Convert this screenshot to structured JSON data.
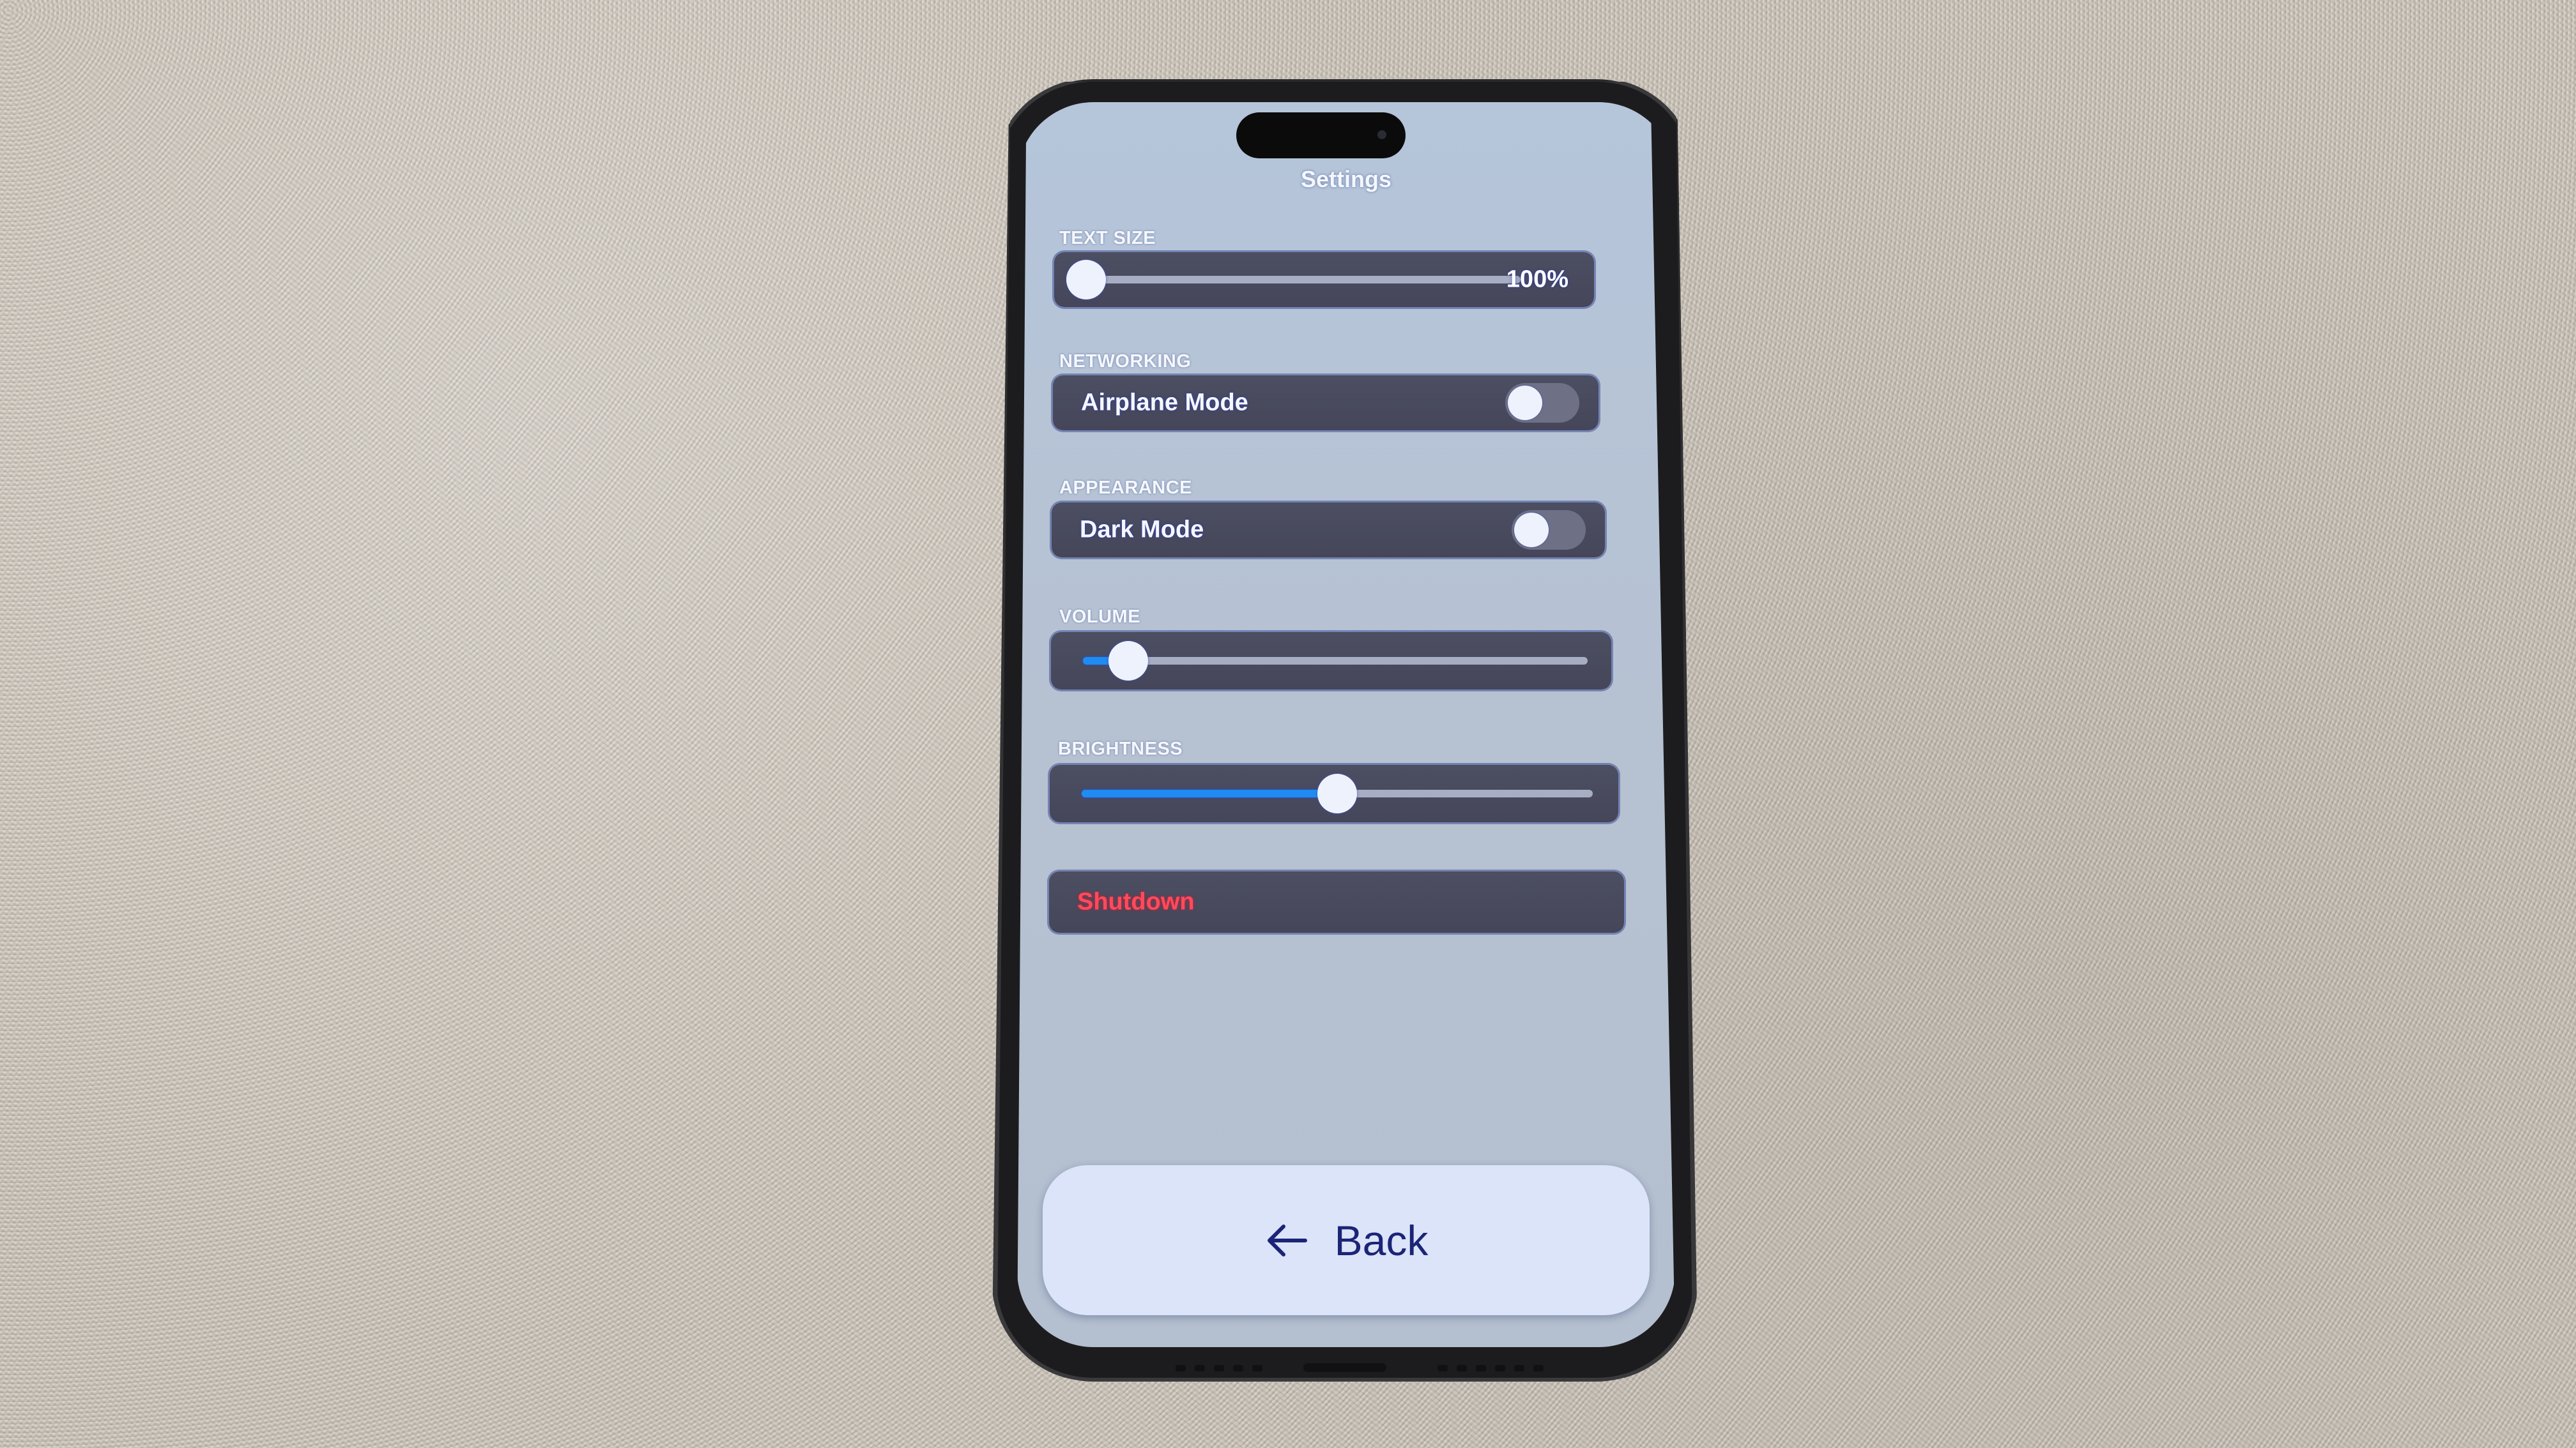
{
  "screen": {
    "title": "Settings"
  },
  "sections": {
    "text_size": {
      "label": "TEXT SIZE",
      "value_text": "100%",
      "slider_fraction": 0.0
    },
    "networking": {
      "label": "NETWORKING",
      "row_label": "Airplane Mode",
      "toggle_on": false
    },
    "appearance": {
      "label": "APPEARANCE",
      "row_label": "Dark Mode",
      "toggle_on": false
    },
    "volume": {
      "label": "VOLUME",
      "slider_fraction": 0.09
    },
    "brightness": {
      "label": "BRIGHTNESS",
      "slider_fraction": 0.5
    },
    "shutdown": {
      "label": "Shutdown"
    }
  },
  "back_button": {
    "label": "Back",
    "icon": "arrow-left-icon"
  },
  "colors": {
    "accent": "#1e8cf0",
    "danger": "#ff4a5c",
    "panel": "#48495d",
    "screen_bg": "#b5c3d6",
    "back_text": "#1b2476"
  }
}
